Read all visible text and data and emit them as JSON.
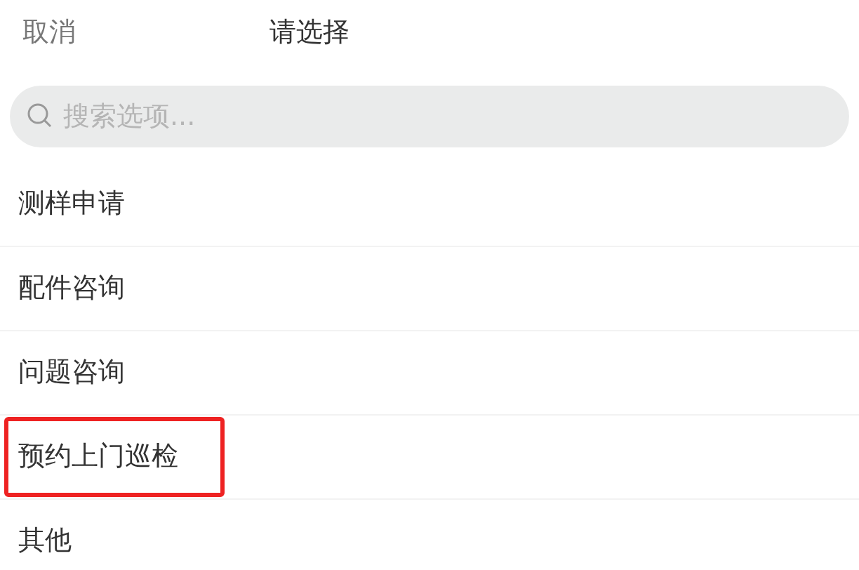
{
  "header": {
    "cancel": "取消",
    "title": "请选择"
  },
  "search": {
    "placeholder": "搜索选项..."
  },
  "options": [
    {
      "label": "测样申请",
      "highlighted": false
    },
    {
      "label": "配件咨询",
      "highlighted": false
    },
    {
      "label": "问题咨询",
      "highlighted": false
    },
    {
      "label": "预约上门巡检",
      "highlighted": true
    },
    {
      "label": "其他",
      "highlighted": false
    }
  ]
}
